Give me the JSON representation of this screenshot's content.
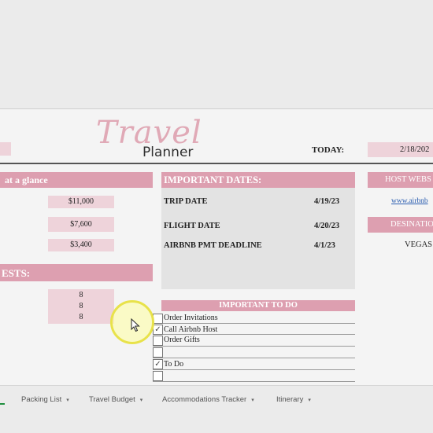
{
  "logo": {
    "line1": "Travel",
    "line2": "Planner"
  },
  "today": {
    "label": "TODAY:",
    "value": "2/18/202"
  },
  "at_a_glance": {
    "header": "at a glance",
    "values": [
      "$11,000",
      "$7,600",
      "$3,400"
    ]
  },
  "guests": {
    "header": "ESTS:",
    "values": [
      "8",
      "8",
      "8"
    ]
  },
  "important_dates": {
    "header": "IMPORTANT DATES:",
    "rows": [
      {
        "label": "TRIP DATE",
        "value": "4/19/23"
      },
      {
        "label": "FLIGHT DATE",
        "value": "4/20/23"
      },
      {
        "label": "AIRBNB PMT DEADLINE",
        "value": "4/1/23"
      }
    ]
  },
  "host_website": {
    "header": "HOST WEBS",
    "link": "www.airbnb"
  },
  "destination": {
    "header": "DESINATIO",
    "value": "VEGAS"
  },
  "todo": {
    "header": "IMPORTANT TO DO",
    "items": [
      {
        "label": "Order Invitations",
        "checked": false
      },
      {
        "label": "Call Airbnb Host",
        "checked": true
      },
      {
        "label": "Order Gifts",
        "checked": false
      },
      {
        "label": "",
        "checked": false
      },
      {
        "label": "To Do",
        "checked": true
      },
      {
        "label": "",
        "checked": false
      }
    ]
  },
  "tabs": {
    "packing": "Packing List",
    "budget": "Travel Budget",
    "accommodations": "Accommodations Tracker",
    "itinerary": "Itinerary"
  },
  "icons": {
    "checkmark": "✓",
    "caret": "▾",
    "pointer": "arrow-cursor"
  },
  "colors": {
    "accent_pink": "#dd9fb0",
    "light_pink": "#eed3da",
    "grey_panel": "#e3e3e3"
  }
}
